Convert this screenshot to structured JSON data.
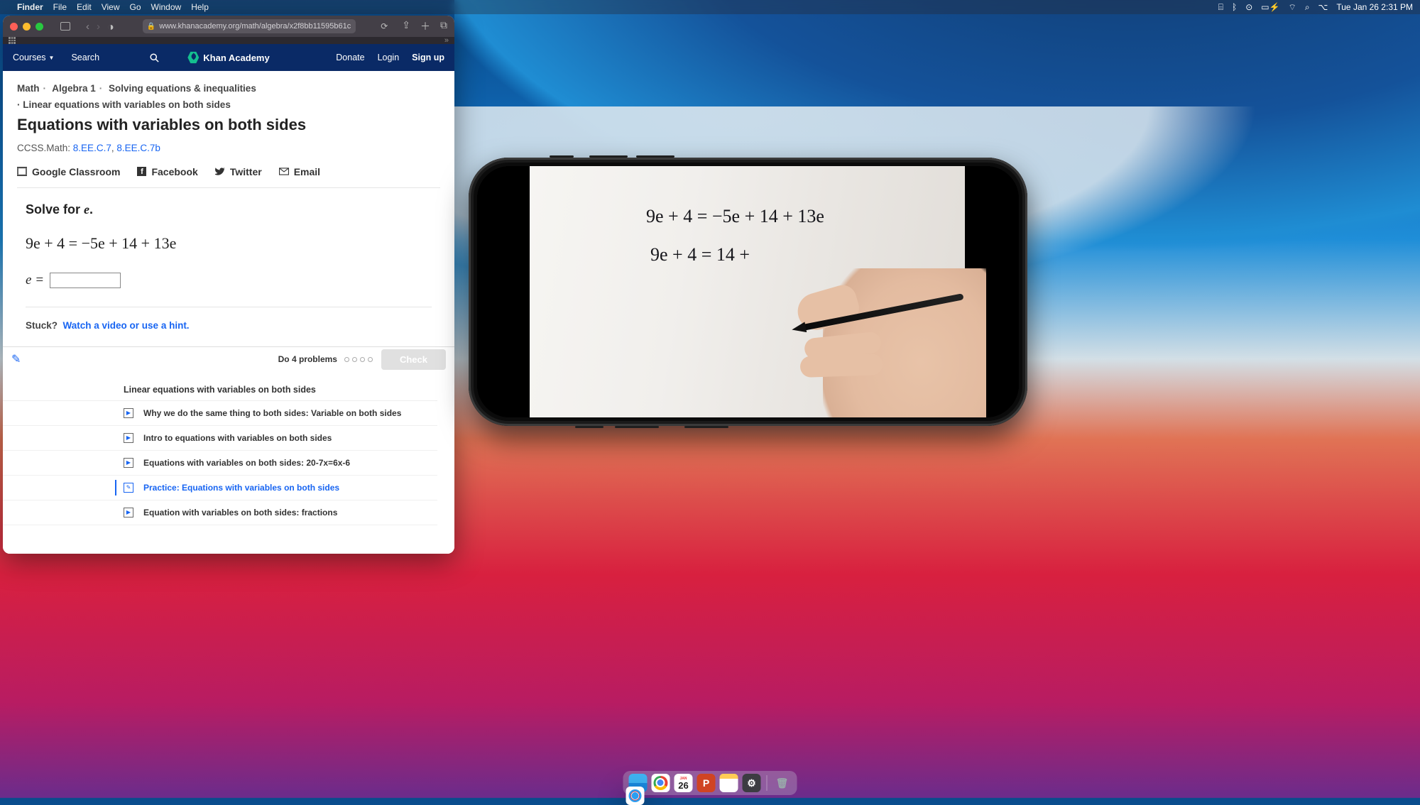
{
  "menubar": {
    "app": "Finder",
    "items": [
      "File",
      "Edit",
      "View",
      "Go",
      "Window",
      "Help"
    ],
    "clock": "Tue Jan 26  2:31 PM"
  },
  "safari": {
    "url": "www.khanacademy.org/math/algebra/x2f8bb11595b61c"
  },
  "khan": {
    "courses": "Courses",
    "search": "Search",
    "brand": "Khan Academy",
    "donate": "Donate",
    "login": "Login",
    "signup": "Sign up"
  },
  "breadcrumbs": {
    "l1": [
      "Math",
      "Algebra 1",
      "Solving equations & inequalities"
    ],
    "l2": "Linear equations with variables on both sides"
  },
  "page_title": "Equations with variables on both sides",
  "ccss": {
    "prefix": "CCSS.Math:",
    "links": [
      "8.EE.C.7",
      "8.EE.C.7b"
    ]
  },
  "share": {
    "gc": "Google Classroom",
    "fb": "Facebook",
    "tw": "Twitter",
    "em": "Email"
  },
  "problem": {
    "prompt_a": "Solve for ",
    "prompt_var": "e",
    "prompt_b": ".",
    "equation": "9e + 4 = −5e + 14 + 13e",
    "ans_a": "e",
    "ans_b": " ="
  },
  "stuck": {
    "label": "Stuck?",
    "link": "Watch a video or use a hint."
  },
  "footer": {
    "do": "Do 4 problems",
    "check": "Check"
  },
  "lessons": {
    "title": "Linear equations with variables on both sides",
    "items": [
      {
        "t": "Why we do the same thing to both sides: Variable on both sides",
        "k": "v"
      },
      {
        "t": "Intro to equations with variables on both sides",
        "k": "v"
      },
      {
        "t": "Equations with variables on both sides: 20-7x=6x-6",
        "k": "v"
      },
      {
        "t": "Practice: Equations with variables on both sides",
        "k": "p",
        "active": true
      },
      {
        "t": "Equation with variables on both sides: fractions",
        "k": "v"
      }
    ]
  },
  "phone": {
    "line1": "9e + 4 = −5e + 14 + 13e",
    "line2": "9e + 4 = 14 +"
  },
  "calendar": {
    "month": "JAN",
    "day": "26"
  }
}
